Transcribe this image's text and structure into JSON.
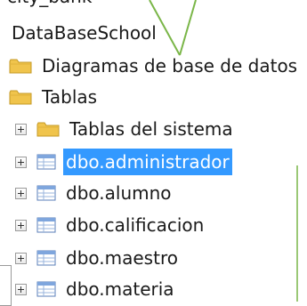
{
  "tree": {
    "truncated_top": "city_bank",
    "database": "DataBaseSchool",
    "folders": {
      "diagrams": "Diagramas de base de datos",
      "tables": "Tablas",
      "system_tables": "Tablas del sistema"
    },
    "tables": [
      {
        "label": "dbo.administrador",
        "selected": true
      },
      {
        "label": "dbo.alumno",
        "selected": false
      },
      {
        "label": "dbo.calificacion",
        "selected": false
      },
      {
        "label": "dbo.maestro",
        "selected": false
      },
      {
        "label": "dbo.materia",
        "selected": false
      }
    ]
  },
  "colors": {
    "selection": "#3399ff",
    "folder": "#f0c44c",
    "annotation_arrow": "#7ab648"
  },
  "icons": {
    "folder": "folder-icon",
    "table": "table-icon",
    "expander": "plus-expander-icon"
  }
}
